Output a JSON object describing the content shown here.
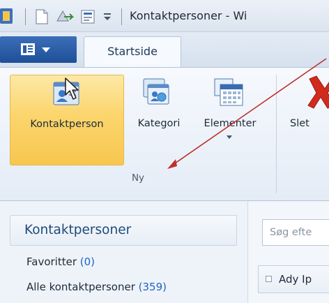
{
  "title_bar": {
    "title": "Kontaktpersoner - Wi"
  },
  "tabs": {
    "start": "Startside"
  },
  "ribbon": {
    "buttons": {
      "kontaktperson": "Kontaktperson",
      "kategori": "Kategori",
      "elementer": "Elementer",
      "slet": "Slet"
    },
    "group_label": "Ny"
  },
  "nav": {
    "header": "Kontaktpersoner",
    "items": [
      {
        "label": "Favoritter ",
        "count": "(0)"
      },
      {
        "label": "Alle kontaktpersoner ",
        "count": "(359)"
      }
    ]
  },
  "content": {
    "search_placeholder": "Søg efte",
    "first_item": "Ady Ip"
  },
  "colors": {
    "selected_button": "#fbd56c",
    "file_tab": "#2a5ea8",
    "accent_text": "#1f64c4",
    "annotation_arrow": "#c0302a"
  }
}
